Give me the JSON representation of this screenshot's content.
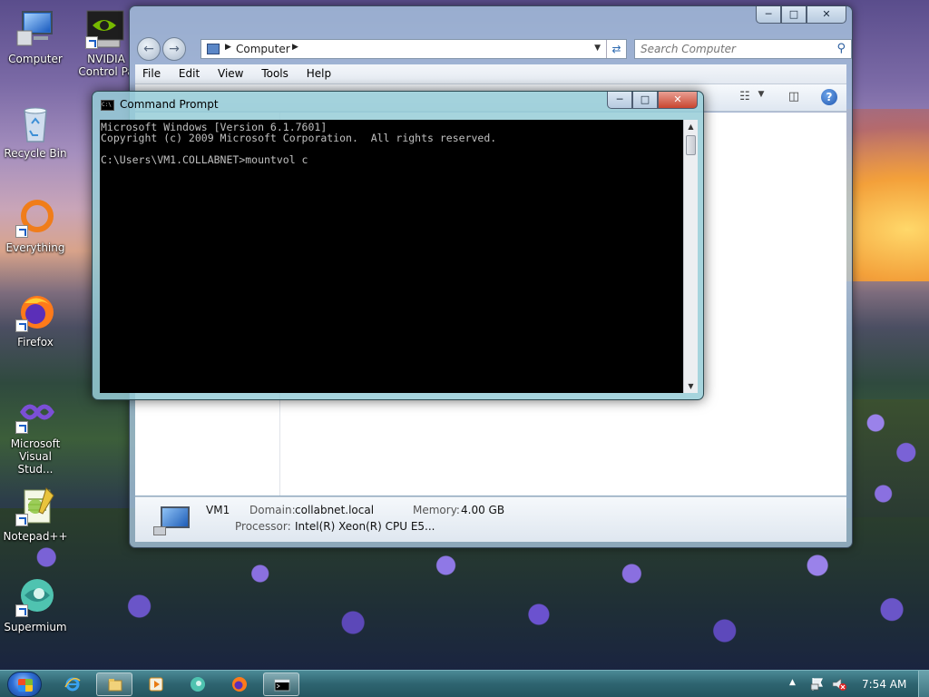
{
  "desktop": {
    "icons": [
      {
        "label": "Computer",
        "icon": "computer-icon"
      },
      {
        "label": "Recycle Bin",
        "icon": "recycle-bin-icon"
      },
      {
        "label": "Everything",
        "icon": "everything-icon"
      },
      {
        "label": "Firefox",
        "icon": "firefox-icon"
      },
      {
        "label": "Microsoft Visual Stud...",
        "icon": "visual-studio-icon"
      },
      {
        "label": "Notepad++",
        "icon": "notepadpp-icon"
      },
      {
        "label": "Supermium",
        "icon": "supermium-icon"
      }
    ],
    "nvidia": {
      "label": "NVIDIA Control Pa",
      "icon": "nvidia-icon"
    }
  },
  "explorer": {
    "address": "Computer",
    "search_placeholder": "Search Computer",
    "menu": [
      "File",
      "Edit",
      "View",
      "Tools",
      "Help"
    ],
    "details": {
      "name": "VM1",
      "domain_label": "Domain:",
      "domain_value": "collabnet.local",
      "memory_label": "Memory:",
      "memory_value": "4.00 GB",
      "processor_label": "Processor:",
      "processor_value": "Intel(R) Xeon(R) CPU E5..."
    }
  },
  "cmd": {
    "title": "Command Prompt",
    "icon_text": "C:\\",
    "lines": [
      "Microsoft Windows [Version 6.1.7601]",
      "Copyright (c) 2009 Microsoft Corporation.  All rights reserved.",
      "",
      "C:\\Users\\VM1.COLLABNET>mountvol c"
    ]
  },
  "taskbar": {
    "clock": "7:54 AM",
    "apps": [
      "internet-explorer-icon",
      "explorer-icon",
      "media-player-icon",
      "supermium-icon",
      "firefox-icon",
      "cmd-icon"
    ]
  },
  "colors": {
    "console_bg": "#000000",
    "console_fg": "#c0c0c0",
    "taskbar": "#2e6470",
    "close_red": "#c9452f"
  }
}
